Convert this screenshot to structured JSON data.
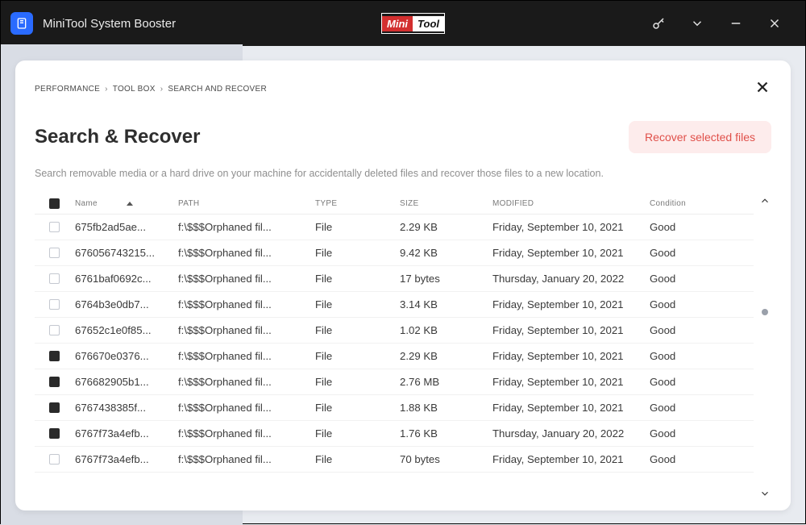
{
  "app": {
    "title": "MiniTool System Booster",
    "brand": {
      "left": "Mini",
      "right": "Tool"
    }
  },
  "breadcrumb": {
    "a": "PERFORMANCE",
    "b": "TOOL BOX",
    "c": "SEARCH AND RECOVER"
  },
  "page": {
    "title": "Search & Recover",
    "desc": "Search removable media or a hard drive on your machine for accidentally deleted files and recover those files to a new location.",
    "recover_btn": "Recover selected files"
  },
  "cols": {
    "name": "Name",
    "path": "PATH",
    "type": "TYPE",
    "size": "SIZE",
    "modified": "MODIFIED",
    "condition": "Condition"
  },
  "rows": [
    {
      "checked": false,
      "name": "675fb2ad5ae...",
      "path": "f:\\$$$Orphaned fil...",
      "type": "File",
      "size": "2.29 KB",
      "modified": "Friday, September 10, 2021",
      "condition": "Good"
    },
    {
      "checked": false,
      "name": "676056743215...",
      "path": "f:\\$$$Orphaned fil...",
      "type": "File",
      "size": "9.42 KB",
      "modified": "Friday, September 10, 2021",
      "condition": "Good"
    },
    {
      "checked": false,
      "name": "6761baf0692c...",
      "path": "f:\\$$$Orphaned fil...",
      "type": "File",
      "size": "17 bytes",
      "modified": "Thursday, January 20, 2022",
      "condition": "Good"
    },
    {
      "checked": false,
      "name": "6764b3e0db7...",
      "path": "f:\\$$$Orphaned fil...",
      "type": "File",
      "size": "3.14 KB",
      "modified": "Friday, September 10, 2021",
      "condition": "Good"
    },
    {
      "checked": false,
      "name": "67652c1e0f85...",
      "path": "f:\\$$$Orphaned fil...",
      "type": "File",
      "size": "1.02 KB",
      "modified": "Friday, September 10, 2021",
      "condition": "Good"
    },
    {
      "checked": true,
      "name": "676670e0376...",
      "path": "f:\\$$$Orphaned fil...",
      "type": "File",
      "size": "2.29 KB",
      "modified": "Friday, September 10, 2021",
      "condition": "Good"
    },
    {
      "checked": true,
      "name": "676682905b1...",
      "path": "f:\\$$$Orphaned fil...",
      "type": "File",
      "size": "2.76 MB",
      "modified": "Friday, September 10, 2021",
      "condition": "Good"
    },
    {
      "checked": true,
      "name": "6767438385f...",
      "path": "f:\\$$$Orphaned fil...",
      "type": "File",
      "size": "1.88 KB",
      "modified": "Friday, September 10, 2021",
      "condition": "Good"
    },
    {
      "checked": true,
      "name": "6767f73a4efb...",
      "path": "f:\\$$$Orphaned fil...",
      "type": "File",
      "size": "1.76 KB",
      "modified": "Thursday, January 20, 2022",
      "condition": "Good"
    },
    {
      "checked": false,
      "name": "6767f73a4efb...",
      "path": "f:\\$$$Orphaned fil...",
      "type": "File",
      "size": "70 bytes",
      "modified": "Friday, September 10, 2021",
      "condition": "Good"
    }
  ]
}
